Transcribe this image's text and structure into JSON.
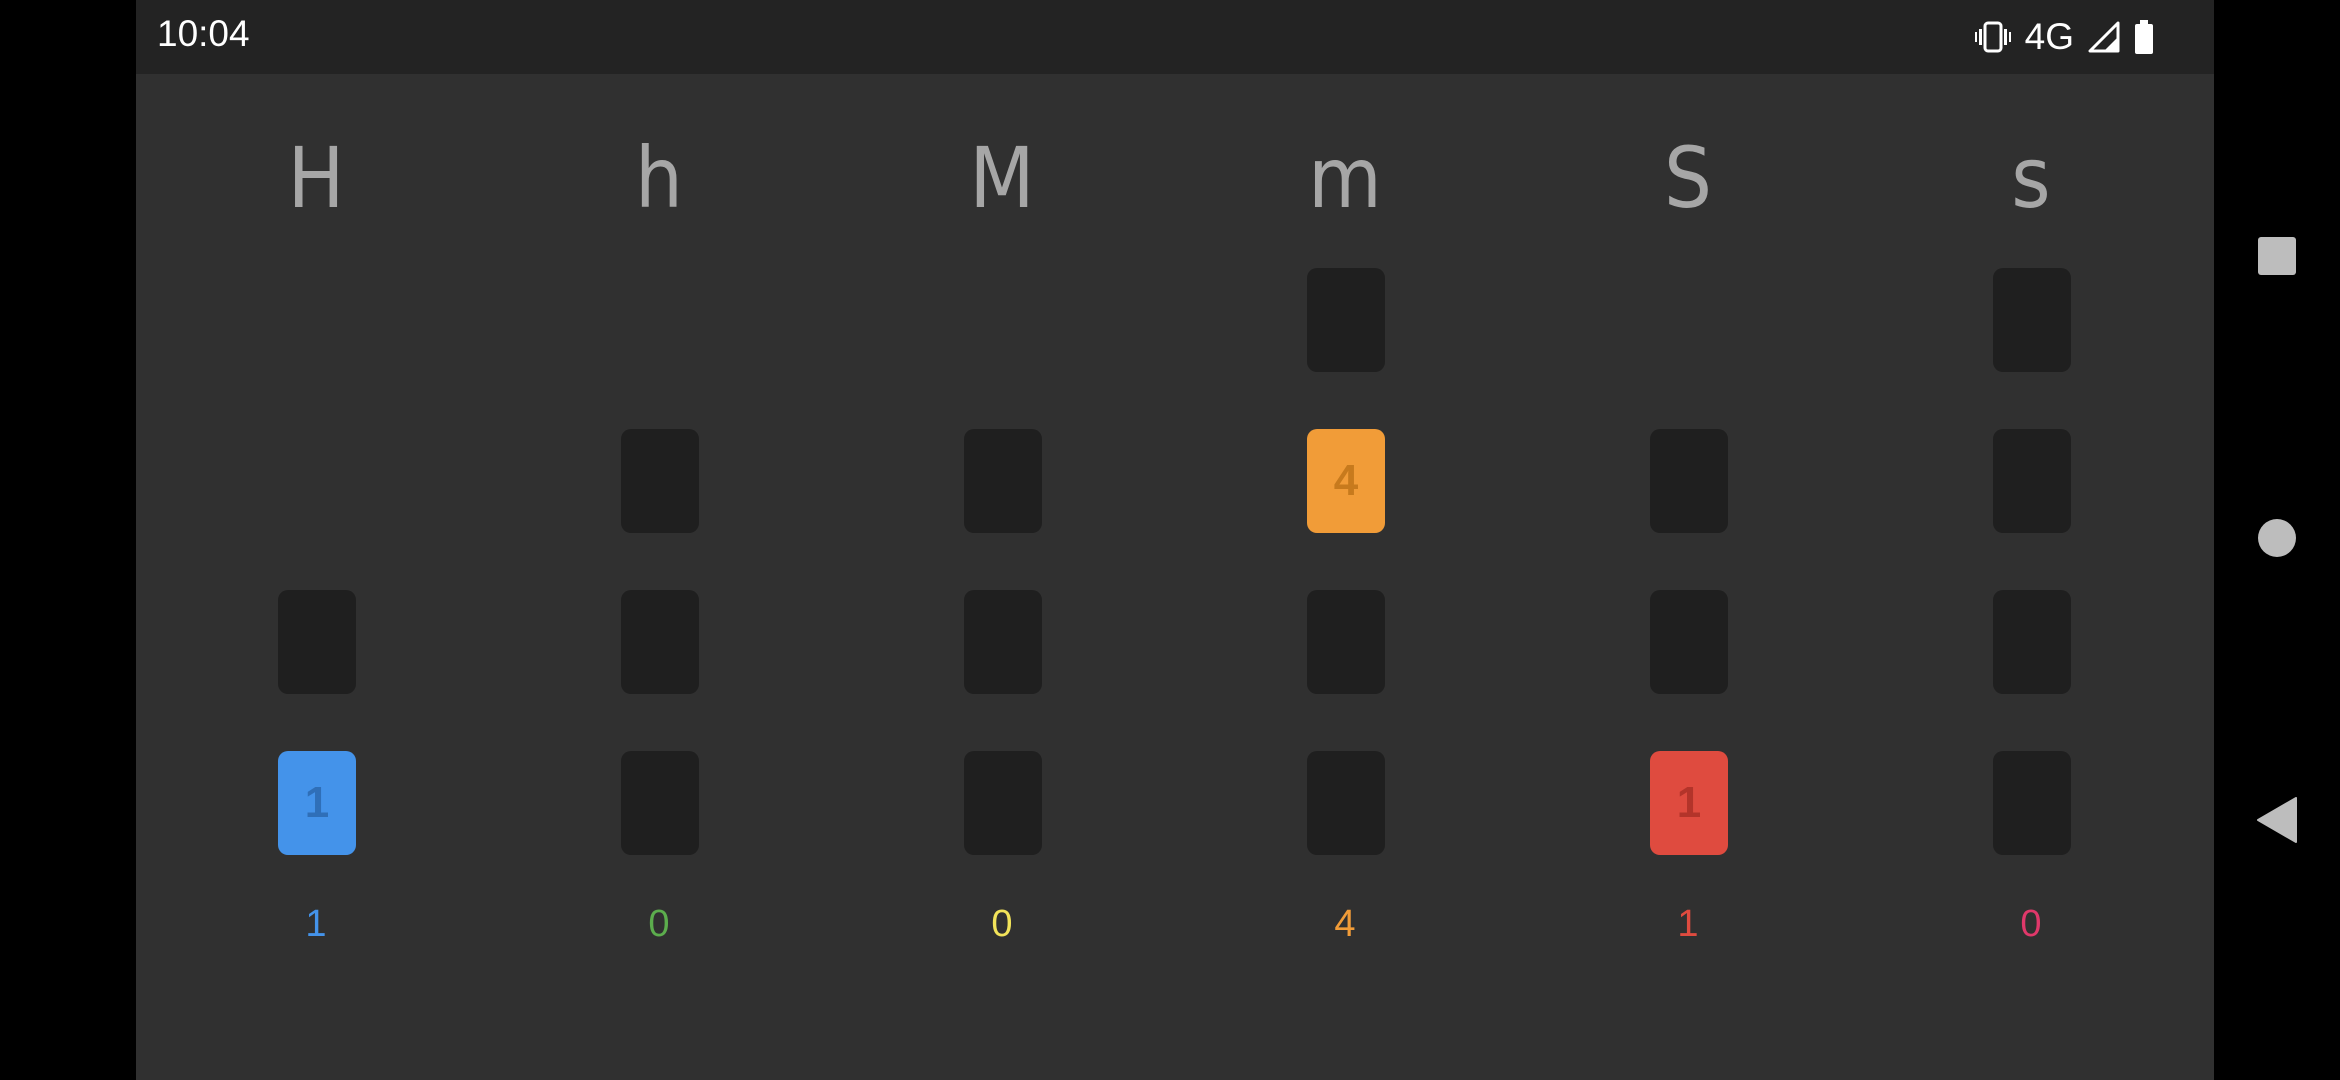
{
  "status_bar": {
    "time": "10:04",
    "network": "4G",
    "icons": [
      "vibrate-icon",
      "signal-icon",
      "battery-icon"
    ]
  },
  "columns": [
    {
      "header": "H",
      "value": "1",
      "color": "#4493ea",
      "lit_digits": {
        "1": "1"
      },
      "slots": 2
    },
    {
      "header": "h",
      "value": "0",
      "color": "#5cad4d",
      "lit_digits": {},
      "slots": 3
    },
    {
      "header": "M",
      "value": "0",
      "color": "#f2e35a",
      "lit_digits": {},
      "slots": 3
    },
    {
      "header": "m",
      "value": "4",
      "color": "#f19c38",
      "lit_digits": {
        "4": "4"
      },
      "slots": 4
    },
    {
      "header": "S",
      "value": "1",
      "color": "#df4b3f",
      "lit_digits": {
        "1": "1"
      },
      "slots": 3
    },
    {
      "header": "s",
      "value": "0",
      "color": "#e0386a",
      "lit_digits": {},
      "slots": 4
    }
  ],
  "nav_bar": {
    "buttons": [
      "recents",
      "home",
      "back"
    ]
  }
}
